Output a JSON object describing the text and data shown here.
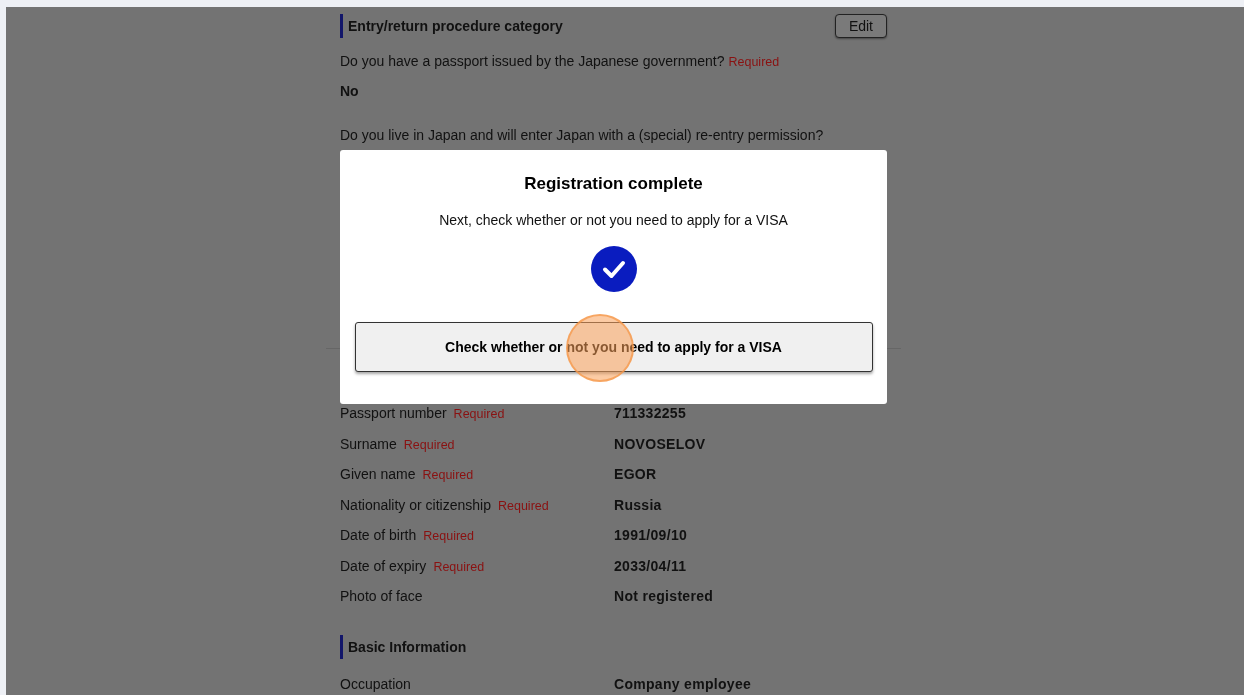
{
  "entry_section": {
    "title": "Entry/return procedure category",
    "edit_button": "Edit",
    "questions": [
      {
        "text": "Do you have a passport issued by the Japanese government?",
        "required": "Required",
        "answer": "No"
      },
      {
        "text": "Do you live in Japan and will enter Japan with a (special) re-entry permission?"
      }
    ]
  },
  "passport_rows": [
    {
      "label": "Passport number",
      "required": "Required",
      "value": "711332255"
    },
    {
      "label": "Surname",
      "required": "Required",
      "value": "NOVOSELOV"
    },
    {
      "label": "Given name",
      "required": "Required",
      "value": "EGOR"
    },
    {
      "label": "Nationality or citizenship",
      "required": "Required",
      "value": "Russia"
    },
    {
      "label": "Date of birth",
      "required": "Required",
      "value": "1991/09/10"
    },
    {
      "label": "Date of expiry",
      "required": "Required",
      "value": "2033/04/11"
    },
    {
      "label": "Photo of face",
      "value": "Not registered"
    }
  ],
  "basic_section": {
    "title": "Basic Information",
    "rows": [
      {
        "label": "Occupation",
        "value": "Company employee"
      }
    ]
  },
  "modal": {
    "title": "Registration complete",
    "message": "Next, check whether or not you need to apply for a VISA",
    "button": "Check whether or not you need to apply for a VISA"
  }
}
